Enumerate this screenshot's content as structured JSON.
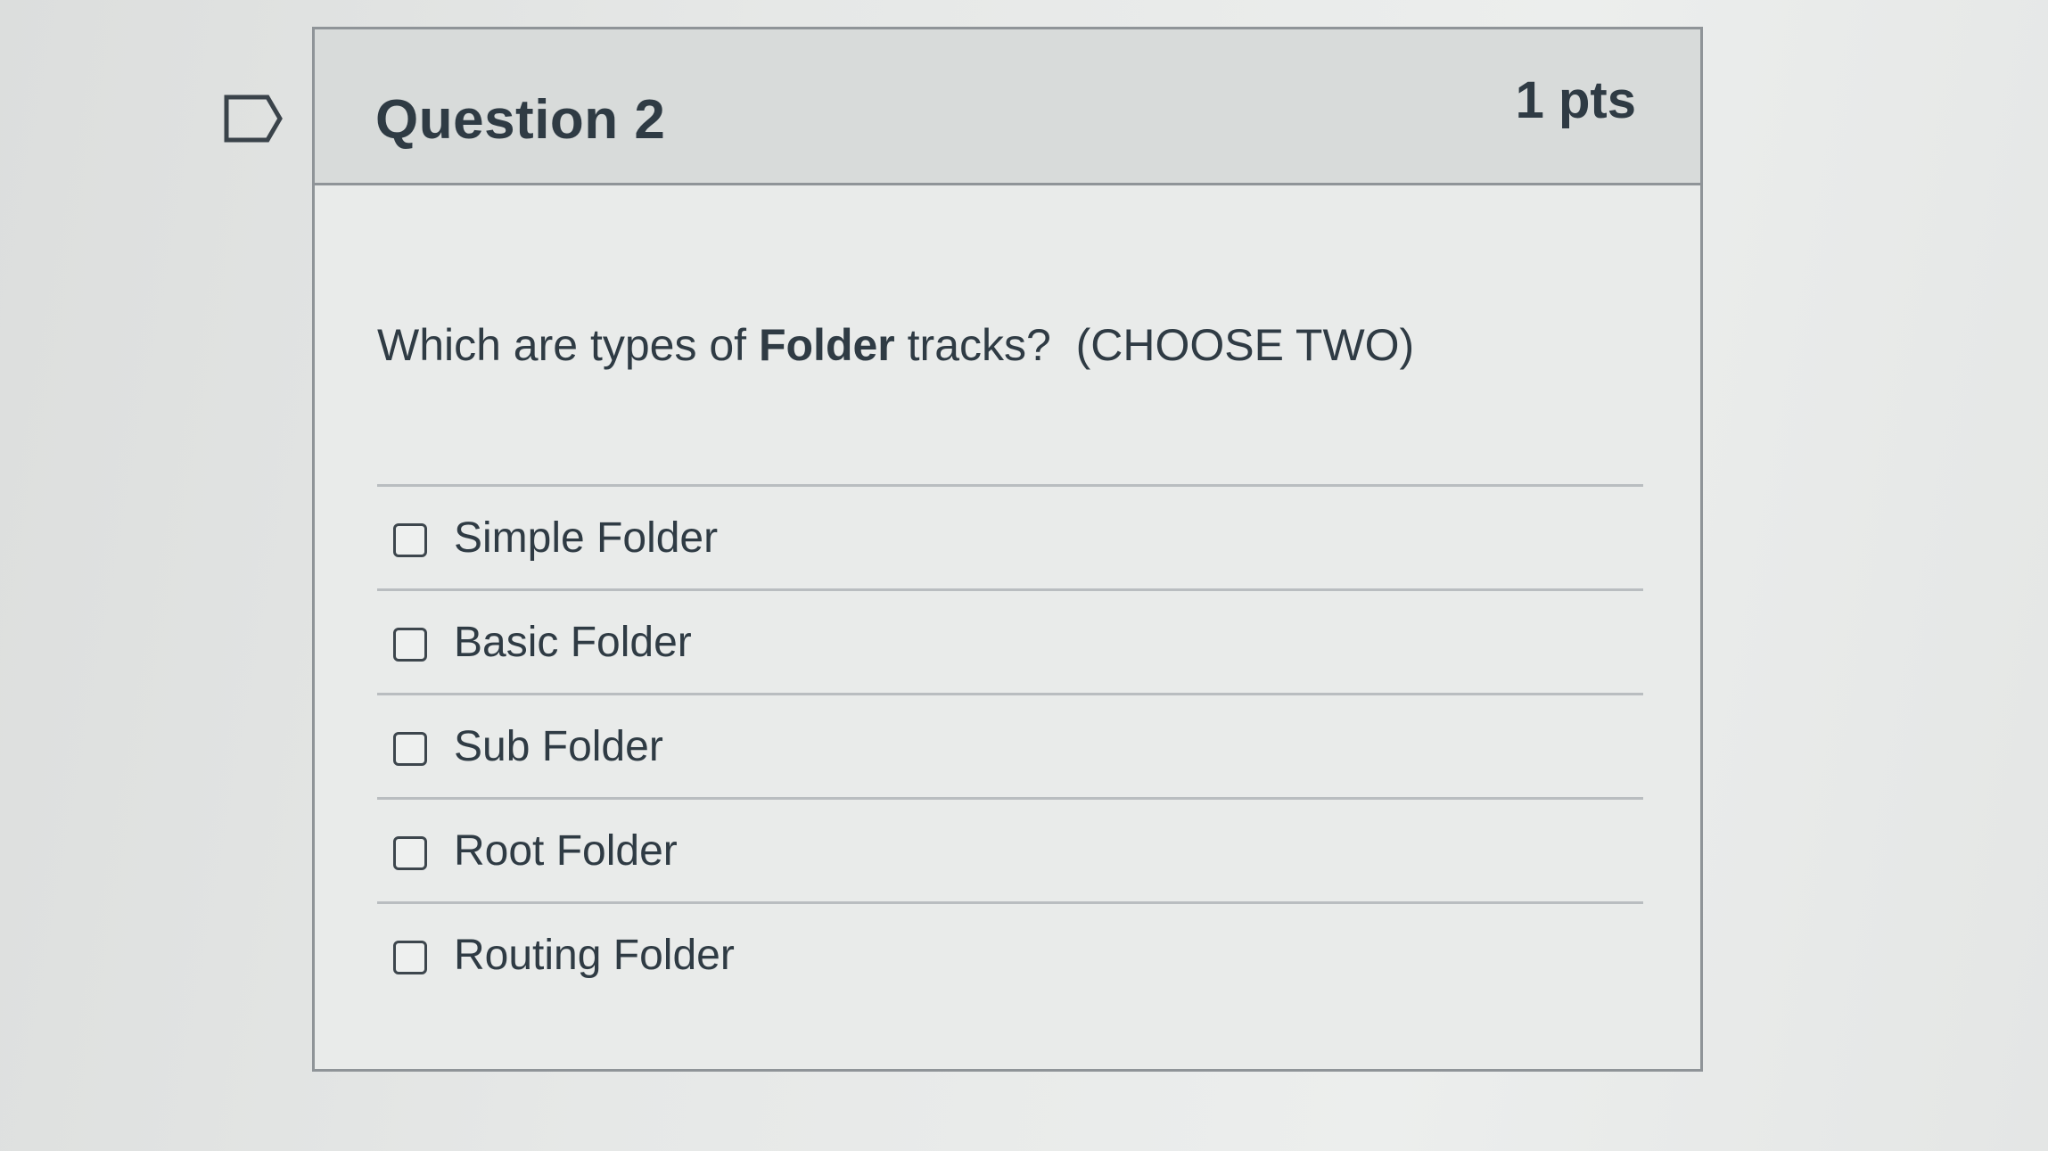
{
  "question": {
    "title": "Question 2",
    "points": "1 pts",
    "text_before": "Which are types of ",
    "text_bold": "Folder",
    "text_after": " tracks?  (CHOOSE TWO)",
    "answers": [
      {
        "label": "Simple Folder",
        "checked": false
      },
      {
        "label": "Basic Folder",
        "checked": false
      },
      {
        "label": "Sub Folder",
        "checked": false
      },
      {
        "label": "Root Folder",
        "checked": false
      },
      {
        "label": "Routing Folder",
        "checked": false
      }
    ]
  },
  "icons": {
    "flag": "flag-question-icon"
  },
  "colors": {
    "text": "#2f3b44",
    "border": "#8f9498",
    "header_bg": "#d8dbda"
  }
}
